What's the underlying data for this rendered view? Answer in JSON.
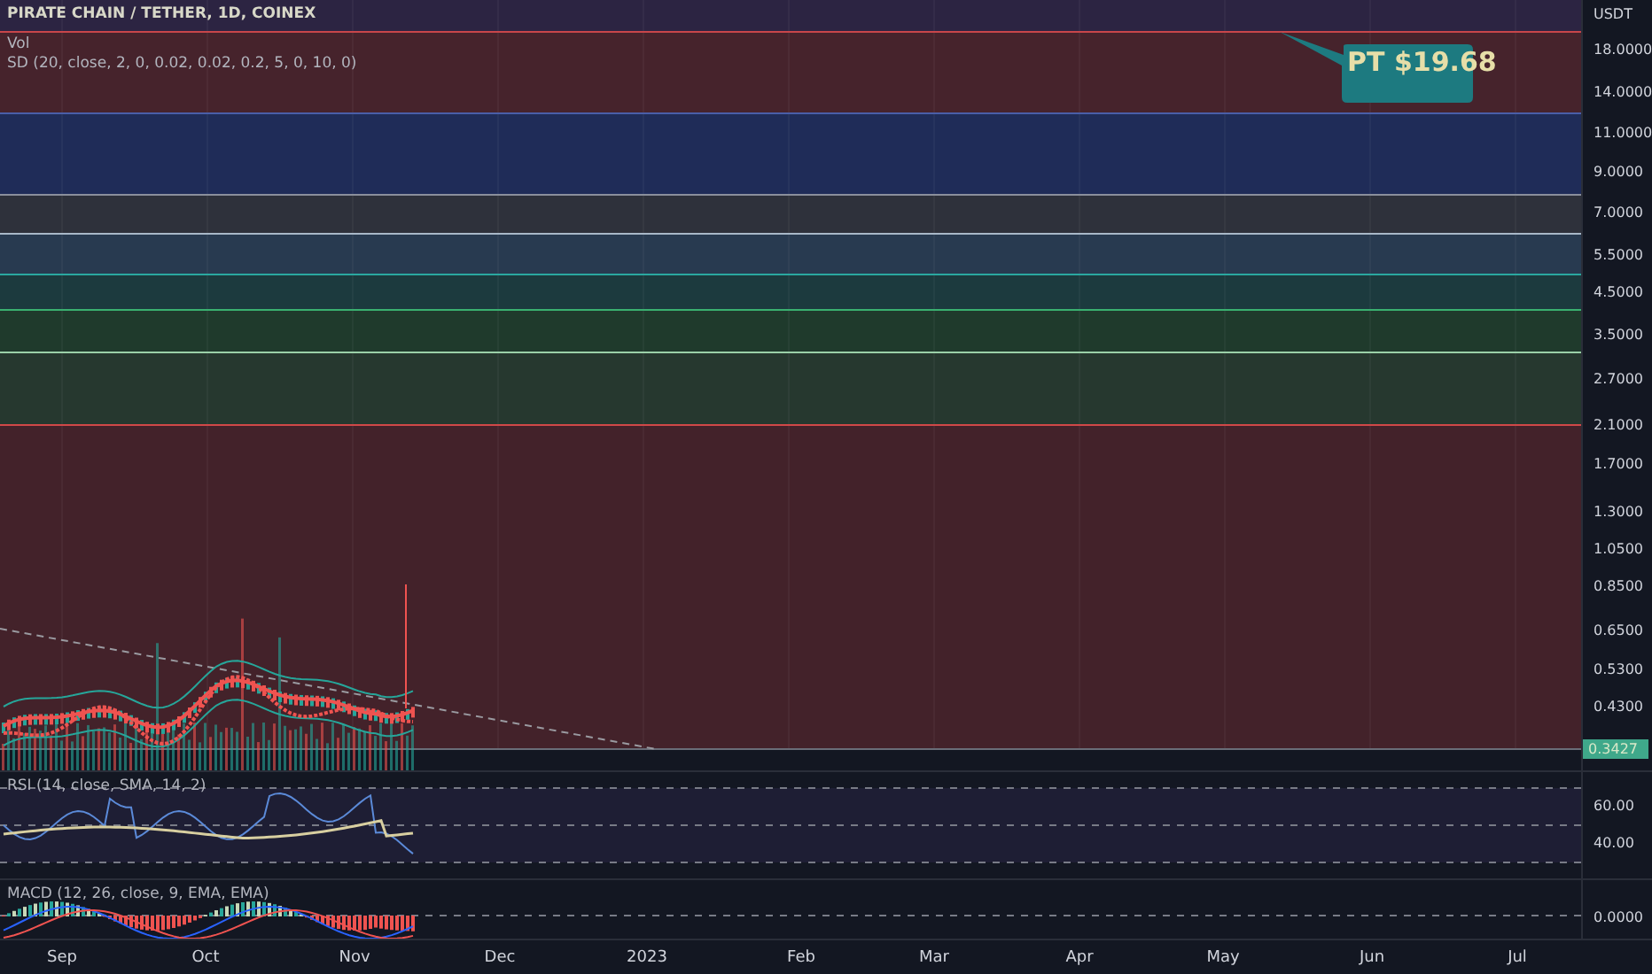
{
  "header": {
    "symbol_title": "PIRATE CHAIN / TETHER, 1D, COINEX",
    "indicators": [
      "Vol",
      "SD (20, close, 2, 0, 0.02, 0.02, 0.2, 5, 0, 10, 0)"
    ]
  },
  "callout": {
    "text": "PT $19.68"
  },
  "price_axis": {
    "unit": "USDT",
    "labels": [
      "18.0000",
      "14.0000",
      "11.0000",
      "9.0000",
      "7.0000",
      "5.5000",
      "4.5000",
      "3.5000",
      "2.7000",
      "2.1000",
      "1.7000",
      "1.3000",
      "1.0500",
      "0.8500",
      "0.6500",
      "0.5300",
      "0.4300"
    ],
    "last_price": "0.3427"
  },
  "rsi": {
    "legend": "RSI (14, close, SMA, 14, 2)",
    "axis_labels": [
      "60.00",
      "40.00"
    ]
  },
  "macd": {
    "legend": "MACD (12, 26, close, 9, EMA, EMA)",
    "axis_labels": [
      "0.0000"
    ]
  },
  "time_axis": {
    "labels": [
      "Sep",
      "Oct",
      "Nov",
      "Dec",
      "2023",
      "Feb",
      "Mar",
      "Apr",
      "May",
      "Jun",
      "Jul"
    ]
  }
}
